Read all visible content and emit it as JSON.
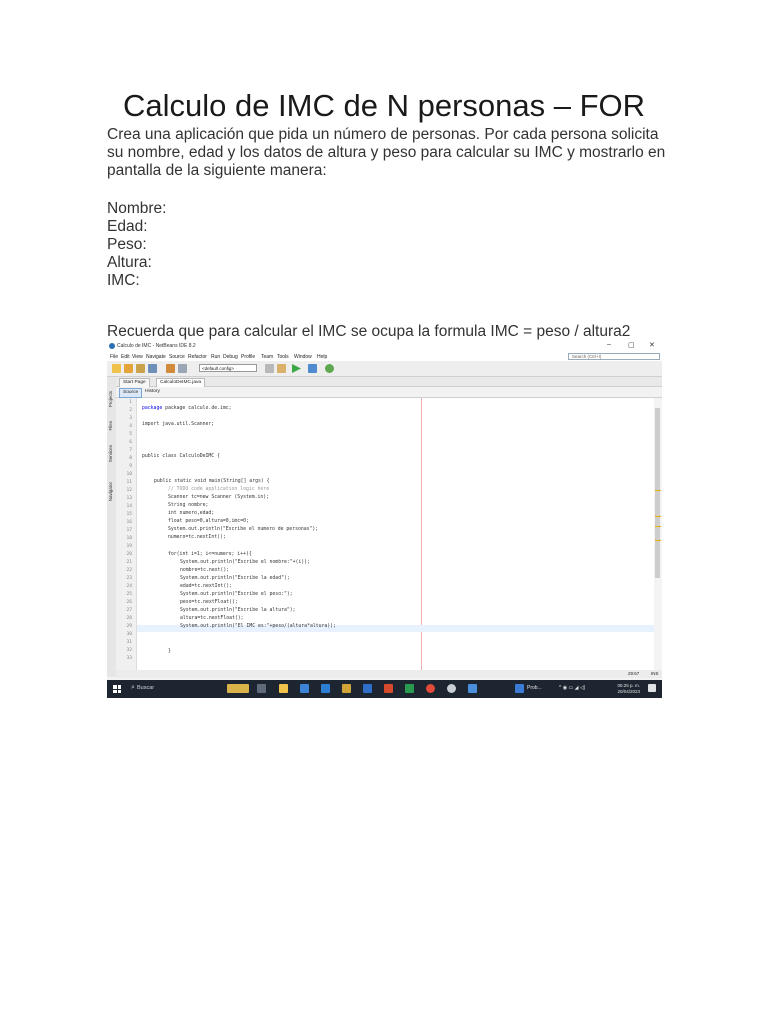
{
  "document": {
    "title": "Calculo de IMC de N personas – FOR",
    "intro": "Crea una aplicación que pida un número de personas. Por cada persona solicita su nombre, edad y los datos de altura y peso para calcular su IMC y mostrarlo en pantalla de la siguiente manera:",
    "fields": [
      "Nombre:",
      "Edad:",
      "Peso:",
      "Altura:",
      "IMC:"
    ],
    "note": "Recuerda que para calcular el IMC se ocupa la formula IMC = peso / altura2"
  },
  "ide": {
    "window_title": "Calculo de IMC - NetBeans IDE 8.2",
    "window_controls": [
      "–",
      "▢",
      "✕"
    ],
    "menu": [
      "File",
      "Edit",
      "View",
      "Navigate",
      "Source",
      "Refactor",
      "Run",
      "Debug",
      "Profile",
      "Team",
      "Tools",
      "Window",
      "Help"
    ],
    "search_placeholder": "Search (Ctrl+I)",
    "config": "<default config>",
    "side_tabs": [
      "Projects",
      "Files",
      "Services",
      "Navigator"
    ],
    "tabs": [
      "Start Page",
      "CalculoDeIMC.java"
    ],
    "editor_tabs": [
      "Source",
      "History"
    ],
    "line_numbers": [
      "1",
      "2",
      "3",
      "4",
      "5",
      "6",
      "7",
      "8",
      "9",
      "10",
      "11",
      "12",
      "13",
      "14",
      "15",
      "16",
      "17",
      "18",
      "19",
      "20",
      "21",
      "22",
      "23",
      "24",
      "25",
      "26",
      "27",
      "28",
      "29",
      "30",
      "31",
      "32",
      "33"
    ],
    "code": [
      "package calculo.de.imc;",
      "import java.util.Scanner;",
      "public class CalculoDeIMC {",
      "public static void main(String[] args) {",
      "// TODO code application logic here",
      "Scanner tc=new Scanner (System.in);",
      "String nombre;",
      "int numero,edad;",
      "float peso=0,altura=0,imc=0;",
      "System.out.println(\"Escribe el numero de personas\");",
      "numero=tc.nextInt();",
      "for(int i=1; i<=numero; i++){",
      "System.out.println(\"Escribe el nombre:\"+(i));",
      "nombre=tc.next();",
      "System.out.println(\"Escribe la edad\");",
      "edad=tc.nextInt();",
      "System.out.println(\"Escribe el peso:\");",
      "peso=tc.nextFloat();",
      "System.out.println(\"Escribe la altura\");",
      "altura=tc.nextFloat();",
      "System.out.println(\"El IMC es:\"+peso/(altura*altura));",
      "}"
    ],
    "status": {
      "position": "29:67",
      "mode": "INS"
    },
    "taskbar": {
      "search": "Buscar",
      "app_label": "Prob...",
      "time": "05:25 p. m.",
      "date": "20/04/2023"
    },
    "colors": {
      "keyword": "#0000e6",
      "string": "#ce7b00",
      "comment": "#999999",
      "taskbar": "#1c2530"
    }
  }
}
